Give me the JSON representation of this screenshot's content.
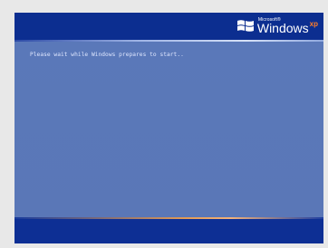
{
  "logo": {
    "microsoft_small": "Microsoft®",
    "windows_text": "Windows",
    "xp_text": "xp"
  },
  "status": {
    "message": "Please wait while Windows prepares to start.."
  },
  "colors": {
    "top_bar": "#0c2e90",
    "body": "#5a78b9",
    "bottom_bar": "#0d2f94",
    "accent_orange": "#ff7d2a"
  }
}
